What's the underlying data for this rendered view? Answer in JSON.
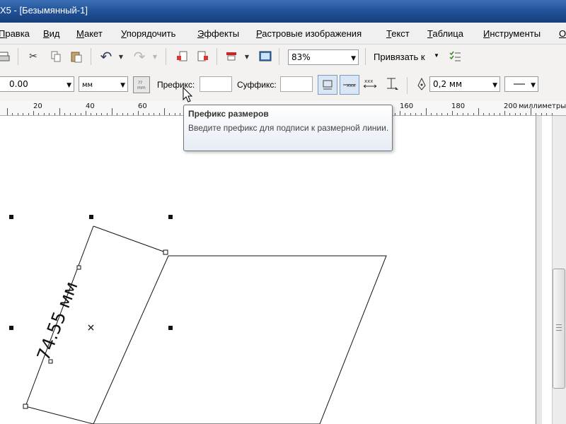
{
  "window": {
    "title": "X5 - [Безымянный-1]"
  },
  "menu": [
    "Правка",
    "Вид",
    "Макет",
    "Упорядочить",
    "Эффекты",
    "Растровые изображения",
    "Текст",
    "Таблица",
    "Инструменты",
    "О"
  ],
  "toolbar1": {
    "zoom": "83%",
    "snap_label": "Привязать к"
  },
  "toolbar2": {
    "precision_value": "0.00",
    "units_value": "мм",
    "prefix_label": "Префикс:",
    "suffix_label": "Суффикс:",
    "prefix_value": "",
    "suffix_value": "",
    "outline_width": "0,2 мм"
  },
  "ruler": {
    "labels": [
      "20",
      "40",
      "60",
      "160",
      "180",
      "200"
    ],
    "unit": "миллиметры"
  },
  "tooltip": {
    "title": "Префикс размеров",
    "description": "Введите префикс для подписи к размерной линии."
  },
  "drawing": {
    "dimension_text": "74.55 мм"
  }
}
